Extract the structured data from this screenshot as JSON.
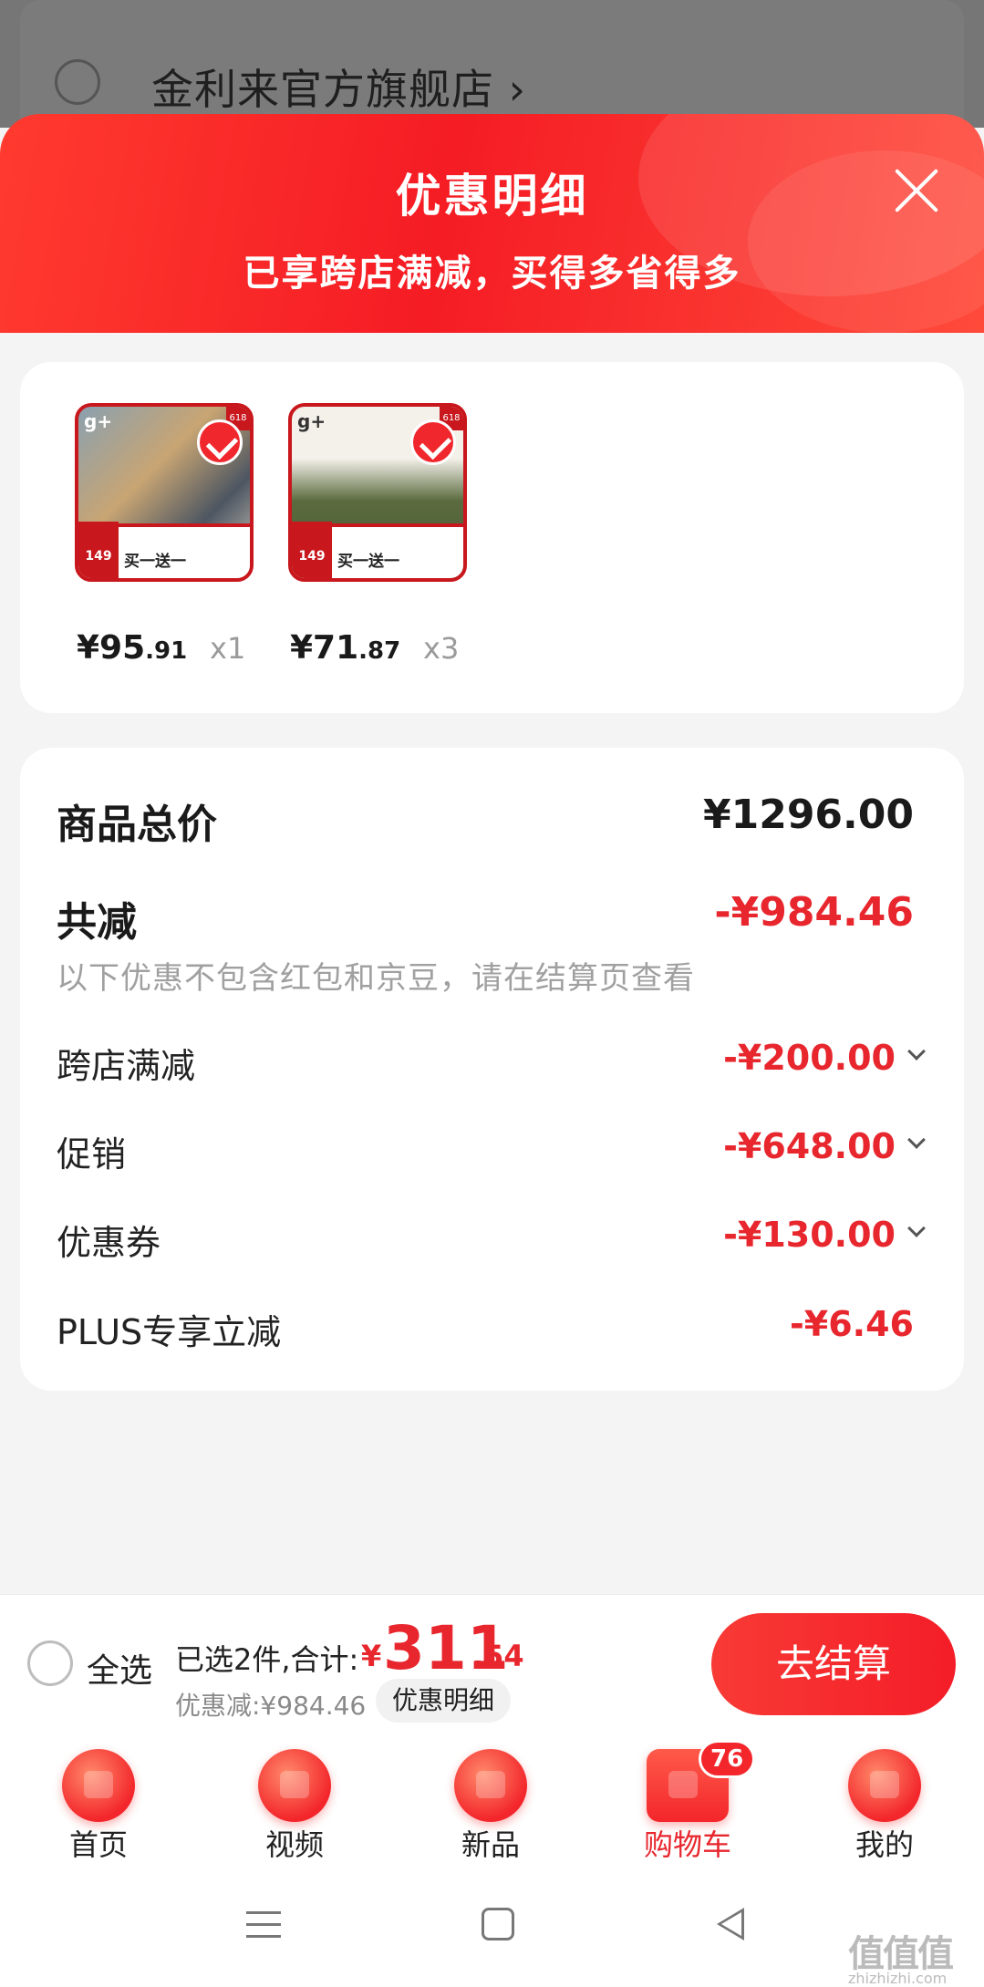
{
  "store": {
    "name": "金利来官方旗舰店 ›"
  },
  "sheet": {
    "title": "优惠明细",
    "subtitle": "已享跨店满减，买得多省得多",
    "header_color": "#f51c24"
  },
  "products": [
    {
      "price_int": "¥95",
      "price_dec": ".91",
      "qty": "x1",
      "logo": "g+",
      "ribbon": "买一送一",
      "tag": "149",
      "badge": "618",
      "icon": "check-icon"
    },
    {
      "price_int": "¥71",
      "price_dec": ".87",
      "qty": "x3",
      "logo": "g+",
      "ribbon": "买一送一",
      "tag": "149",
      "badge": "618",
      "icon": "check-icon"
    }
  ],
  "summary": {
    "total_label": "商品总价",
    "total_value": "¥1296.00",
    "reduce_label": "共减",
    "reduce_value": "-¥984.46",
    "note": "以下优惠不包含红包和京豆，请在结算页查看",
    "items": [
      {
        "label": "跨店满减",
        "value": "-¥200.00"
      },
      {
        "label": "促销",
        "value": "-¥648.00"
      },
      {
        "label": "优惠券",
        "value": "-¥130.00"
      },
      {
        "label": "PLUS专享立减",
        "value": "-¥6.46"
      }
    ]
  },
  "checkout": {
    "select_all": "全选",
    "selected_text": "已选2件,合计:",
    "sum_yen": "¥",
    "sum_int": "311",
    "sum_dec": ".54",
    "discount_text": "优惠减:¥984.46",
    "detail_button": "优惠明细",
    "checkout_button": "去结算",
    "accent_color": "#e8262d"
  },
  "tabs": [
    {
      "label": "首页",
      "icon": "home-icon"
    },
    {
      "label": "视频",
      "icon": "video-icon"
    },
    {
      "label": "新品",
      "icon": "new-product-icon"
    },
    {
      "label": "购物车",
      "icon": "cart-icon",
      "badge": "76",
      "active": true
    },
    {
      "label": "我的",
      "icon": "profile-icon"
    }
  ],
  "watermark": {
    "logo": "值值值",
    "text": "zhizhizhi.com"
  }
}
